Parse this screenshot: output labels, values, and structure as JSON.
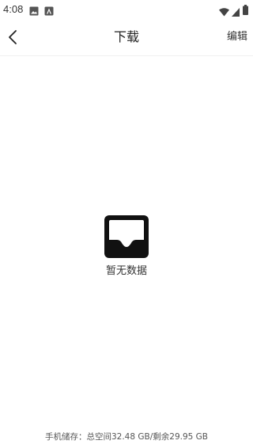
{
  "status_bar": {
    "time": "4:08",
    "left_icons": [
      "image-icon",
      "android-icon"
    ],
    "right_icons": [
      "wifi-icon",
      "cellular-icon",
      "battery-icon"
    ]
  },
  "header": {
    "title": "下载",
    "edit_label": "编辑",
    "back_icon": "chevron-left-icon"
  },
  "empty_state": {
    "icon": "inbox-icon",
    "message": "暂无数据"
  },
  "footer": {
    "storage_text": "手机储存：总空间32.48 GB/剩余29.95 GB"
  },
  "colors": {
    "background": "#ffffff",
    "text": "#222222",
    "icon": "#111111"
  }
}
